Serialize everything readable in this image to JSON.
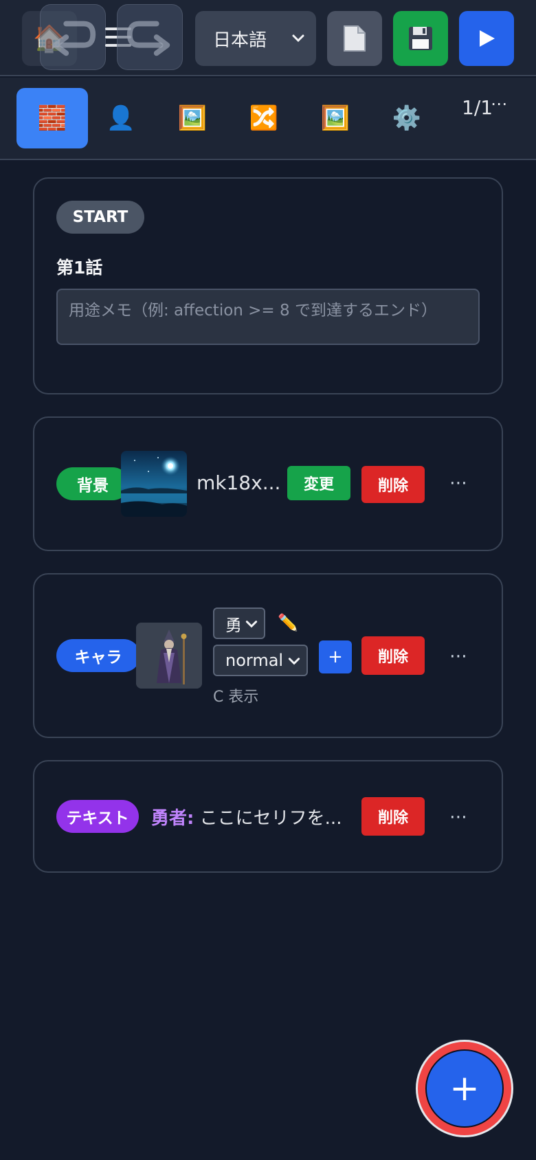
{
  "toolbar": {
    "home_icon": "🏠",
    "language": "日本語",
    "doc_icon": "📄",
    "save_icon": "💾",
    "play_icon": "▶"
  },
  "tabs": [
    {
      "icon": "🧱",
      "name": "blocks",
      "active": true
    },
    {
      "icon": "👤",
      "name": "characters",
      "active": false
    },
    {
      "icon": "🖼️",
      "name": "backgrounds",
      "active": false
    },
    {
      "icon": "🔀",
      "name": "branches",
      "active": false
    },
    {
      "icon": "🖼️",
      "name": "images",
      "active": false
    },
    {
      "icon": "⚙️",
      "name": "settings",
      "active": false
    }
  ],
  "pager": {
    "text": "1/1",
    "more": "⋯"
  },
  "start_card": {
    "badge": "START",
    "title": "第1話",
    "memo_placeholder": "用途メモ（例: affection >= 8 で到達するエンド）"
  },
  "background_card": {
    "badge": "背景",
    "filename": "mk18x...",
    "change_label": "変更",
    "delete_label": "削除",
    "more": "⋯"
  },
  "character_card": {
    "badge": "キャラ",
    "character_select": "勇",
    "edit_icon": "✏️",
    "expression_select": "normal",
    "add_label": "+",
    "delete_label": "削除",
    "position_text": "C 表示",
    "more": "⋯"
  },
  "text_card": {
    "badge": "テキスト",
    "speaker": "勇者:",
    "line": "ここにセリフを...",
    "delete_label": "削除",
    "more": "⋯"
  },
  "fab": {
    "label": "+"
  },
  "colors": {
    "bg": "#131a2a",
    "accent_blue": "#2563eb",
    "green": "#16a34a",
    "red": "#dc2626",
    "purple": "#9333ea",
    "speaker_purple": "#c084fc"
  }
}
